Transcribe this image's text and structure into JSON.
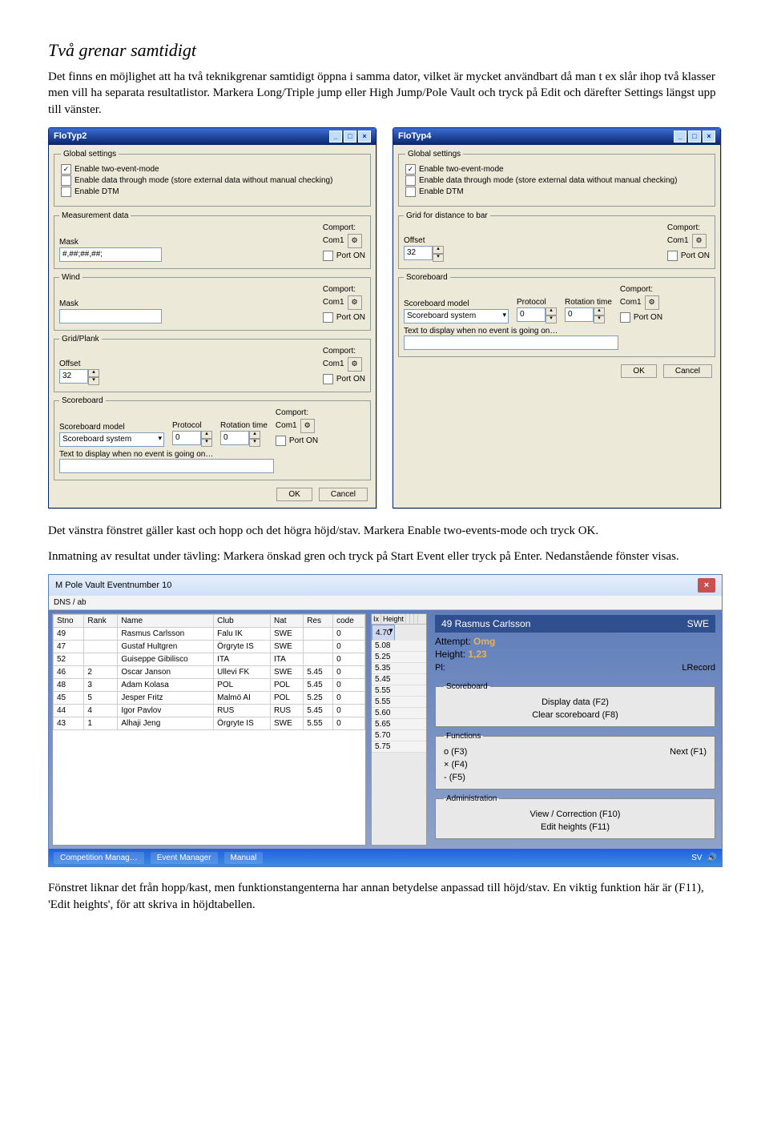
{
  "heading": "Två grenar samtidigt",
  "para1": "Det finns en möjlighet att ha två teknikgrenar samtidigt öppna i samma dator, vilket är mycket användbart då man t ex slår ihop två klasser men vill ha separata resultatlistor. Markera Long/Triple jump eller High Jump/Pole Vault och tryck på Edit och därefter Settings längst upp till vänster.",
  "para2": "Det vänstra fönstret gäller kast och hopp och det högra höjd/stav. Markera Enable two-events-mode och tryck OK.",
  "para3": "Inmatning av resultat under tävling: Markera önskad gren och tryck på Start Event eller tryck på Enter. Nedanstående fönster visas.",
  "para4": "Fönstret liknar det från hopp/kast, men funktionstangenterna har annan betydelse anpassad till höjd/stav. En viktig funktion här är (F11), 'Edit heights', för att skriva in höjdtabellen.",
  "win1": {
    "title": "FloTyp2",
    "gsLegend": "Global settings",
    "chk1": "Enable two-event-mode",
    "chk2": "Enable data through mode (store external data without manual checking)",
    "chk3": "Enable DTM",
    "measLegend": "Measurement data",
    "maskLabel": "Mask",
    "maskValue": "#,##;##,##;",
    "comportLabel": "Comport:",
    "comVal": "Com1",
    "portOn": "Port ON",
    "windLegend": "Wind",
    "gridLegend": "Grid/Plank",
    "offsetLabel": "Offset",
    "offsetValue": "32",
    "sbLegend": "Scoreboard",
    "sbModelLabel": "Scoreboard model",
    "sbModel": "Scoreboard system",
    "protocolLabel": "Protocol",
    "protocolValue": "0",
    "rotLabel": "Rotation time",
    "rotValue": "0",
    "noEvent": "Text to display when no event is going on…",
    "ok": "OK",
    "cancel": "Cancel"
  },
  "win2": {
    "title": "FloTyp4",
    "gsLegend": "Global settings",
    "chk1": "Enable two-event-mode",
    "chk2": "Enable data through mode (store external data without manual checking)",
    "chk3": "Enable DTM",
    "gridLegend": "Grid for distance to bar",
    "offsetLabel": "Offset",
    "offsetValue": "32",
    "comportLabel": "Comport:",
    "comVal": "Com1",
    "portOn": "Port ON",
    "sbLegend": "Scoreboard",
    "sbModelLabel": "Scoreboard model",
    "sbModel": "Scoreboard system",
    "protocolLabel": "Protocol",
    "protocolValue": "0",
    "rotLabel": "Rotation time",
    "rotValue": "0",
    "noEvent": "Text to display when no event is going on…",
    "ok": "OK",
    "cancel": "Cancel"
  },
  "win3": {
    "title": "M Pole Vault Eventnumber 10",
    "toolbar": "DNS / ab",
    "cols": [
      "Stno",
      "Rank",
      "Name",
      "Club",
      "Nat",
      "Res",
      "code"
    ],
    "rows": [
      {
        "stno": "49",
        "rank": "",
        "name": "Rasmus Carlsson",
        "club": "Falu IK",
        "nat": "SWE",
        "res": "",
        "code": "0"
      },
      {
        "stno": "47",
        "rank": "",
        "name": "Gustaf Hultgren",
        "club": "Örgryte IS",
        "nat": "SWE",
        "res": "",
        "code": "0"
      },
      {
        "stno": "52",
        "rank": "",
        "name": "Guiseppe Gibilisco",
        "club": "ITA",
        "nat": "ITA",
        "res": "",
        "code": "0"
      },
      {
        "stno": "46",
        "rank": "2",
        "name": "Oscar Janson",
        "club": "Ullevi FK",
        "nat": "SWE",
        "res": "5.45",
        "code": "0"
      },
      {
        "stno": "48",
        "rank": "3",
        "name": "Adam Kolasa",
        "club": "POL",
        "nat": "POL",
        "res": "5.45",
        "code": "0"
      },
      {
        "stno": "45",
        "rank": "5",
        "name": "Jesper Fritz",
        "club": "Malmö AI",
        "nat": "POL",
        "res": "5.25",
        "code": "0"
      },
      {
        "stno": "44",
        "rank": "4",
        "name": "Igor Pavlov",
        "club": "RUS",
        "nat": "RUS",
        "res": "5.45",
        "code": "0"
      },
      {
        "stno": "43",
        "rank": "1",
        "name": "Alhaji Jeng",
        "club": "Örgryte IS",
        "nat": "SWE",
        "res": "5.55",
        "code": "0"
      }
    ],
    "hhdr": [
      "Ix",
      "Height",
      "",
      "",
      ""
    ],
    "heights": [
      "4.70",
      "5.08",
      "5.25",
      "5.35",
      "5.45",
      "5.55",
      "5.55",
      "5.60",
      "5.65",
      "5.70",
      "5.75"
    ],
    "athleteName": "49 Rasmus Carlsson",
    "athleteNat": "SWE",
    "attemptLabel": "Attempt:",
    "attemptVal": "Omg",
    "heightLabel": "Height:",
    "heightVal": "1,23",
    "plLabel": "Pl:",
    "lrecord": "LRecord",
    "sbLegend": "Scoreboard",
    "sb1": "Display data (F2)",
    "sb2": "Clear scoreboard (F8)",
    "fnLegend": "Functions",
    "fn_o": "o  (F3)",
    "fn_next": "Next (F1)",
    "fn_x": "×  (F4)",
    "fn_dash": "-  (F5)",
    "admLegend": "Administration",
    "adm1": "View / Correction (F10)",
    "adm2": "Edit heights (F11)",
    "task1": "Competition Manag…",
    "task2": "Event Manager",
    "task3": "Manual",
    "trayLang": "SV"
  }
}
